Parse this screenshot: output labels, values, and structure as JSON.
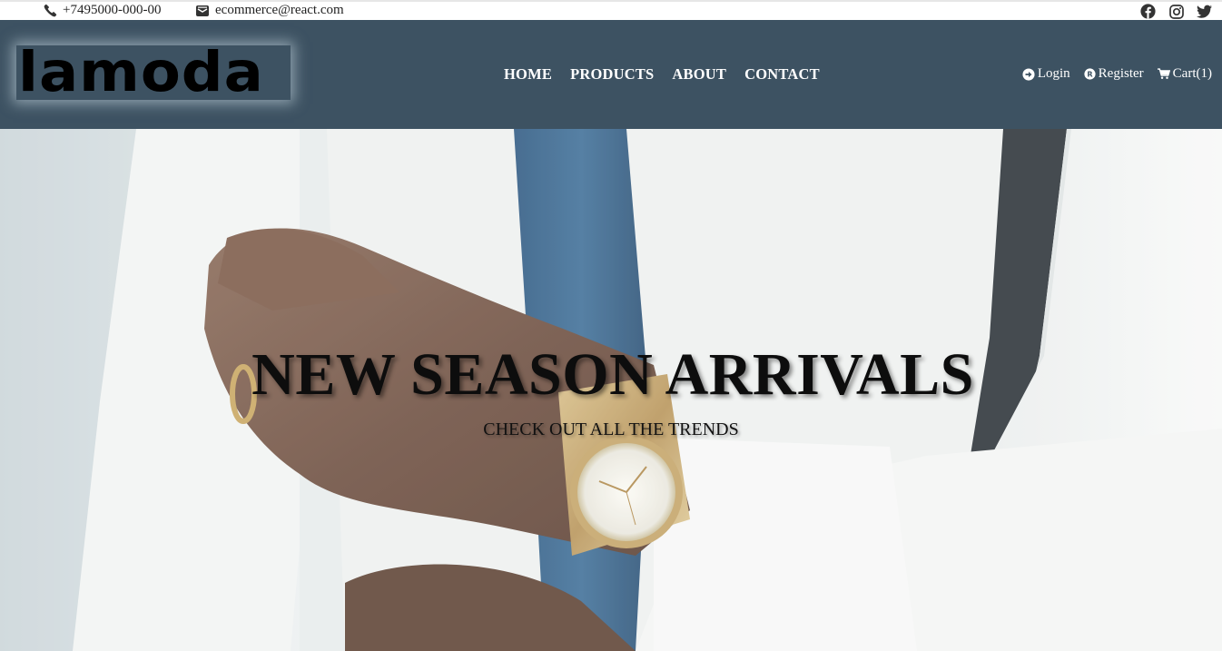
{
  "topbar": {
    "phone": "+7495000-000-00",
    "email": "ecommerce@react.com",
    "icons": {
      "phone": "phone-icon",
      "email": "envelope-icon"
    },
    "socials": [
      "facebook-icon",
      "instagram-icon",
      "twitter-icon"
    ]
  },
  "header": {
    "logo": "lamoda",
    "nav": [
      "HOME",
      "PRODUCTS",
      "ABOUT",
      "CONTACT"
    ],
    "account": {
      "login": "Login",
      "register": "Register",
      "cart": "Cart(1)",
      "icons": [
        "sign-in-icon",
        "register-icon",
        "cart-icon"
      ]
    }
  },
  "hero": {
    "title": "NEW SEASON ARRIVALS",
    "subtitle": "CHECK OUT ALL THE TRENDS"
  },
  "colors": {
    "header_bg": "#3d5262",
    "nav_text": "#ffffff",
    "topbar_bg": "#ffffff"
  }
}
